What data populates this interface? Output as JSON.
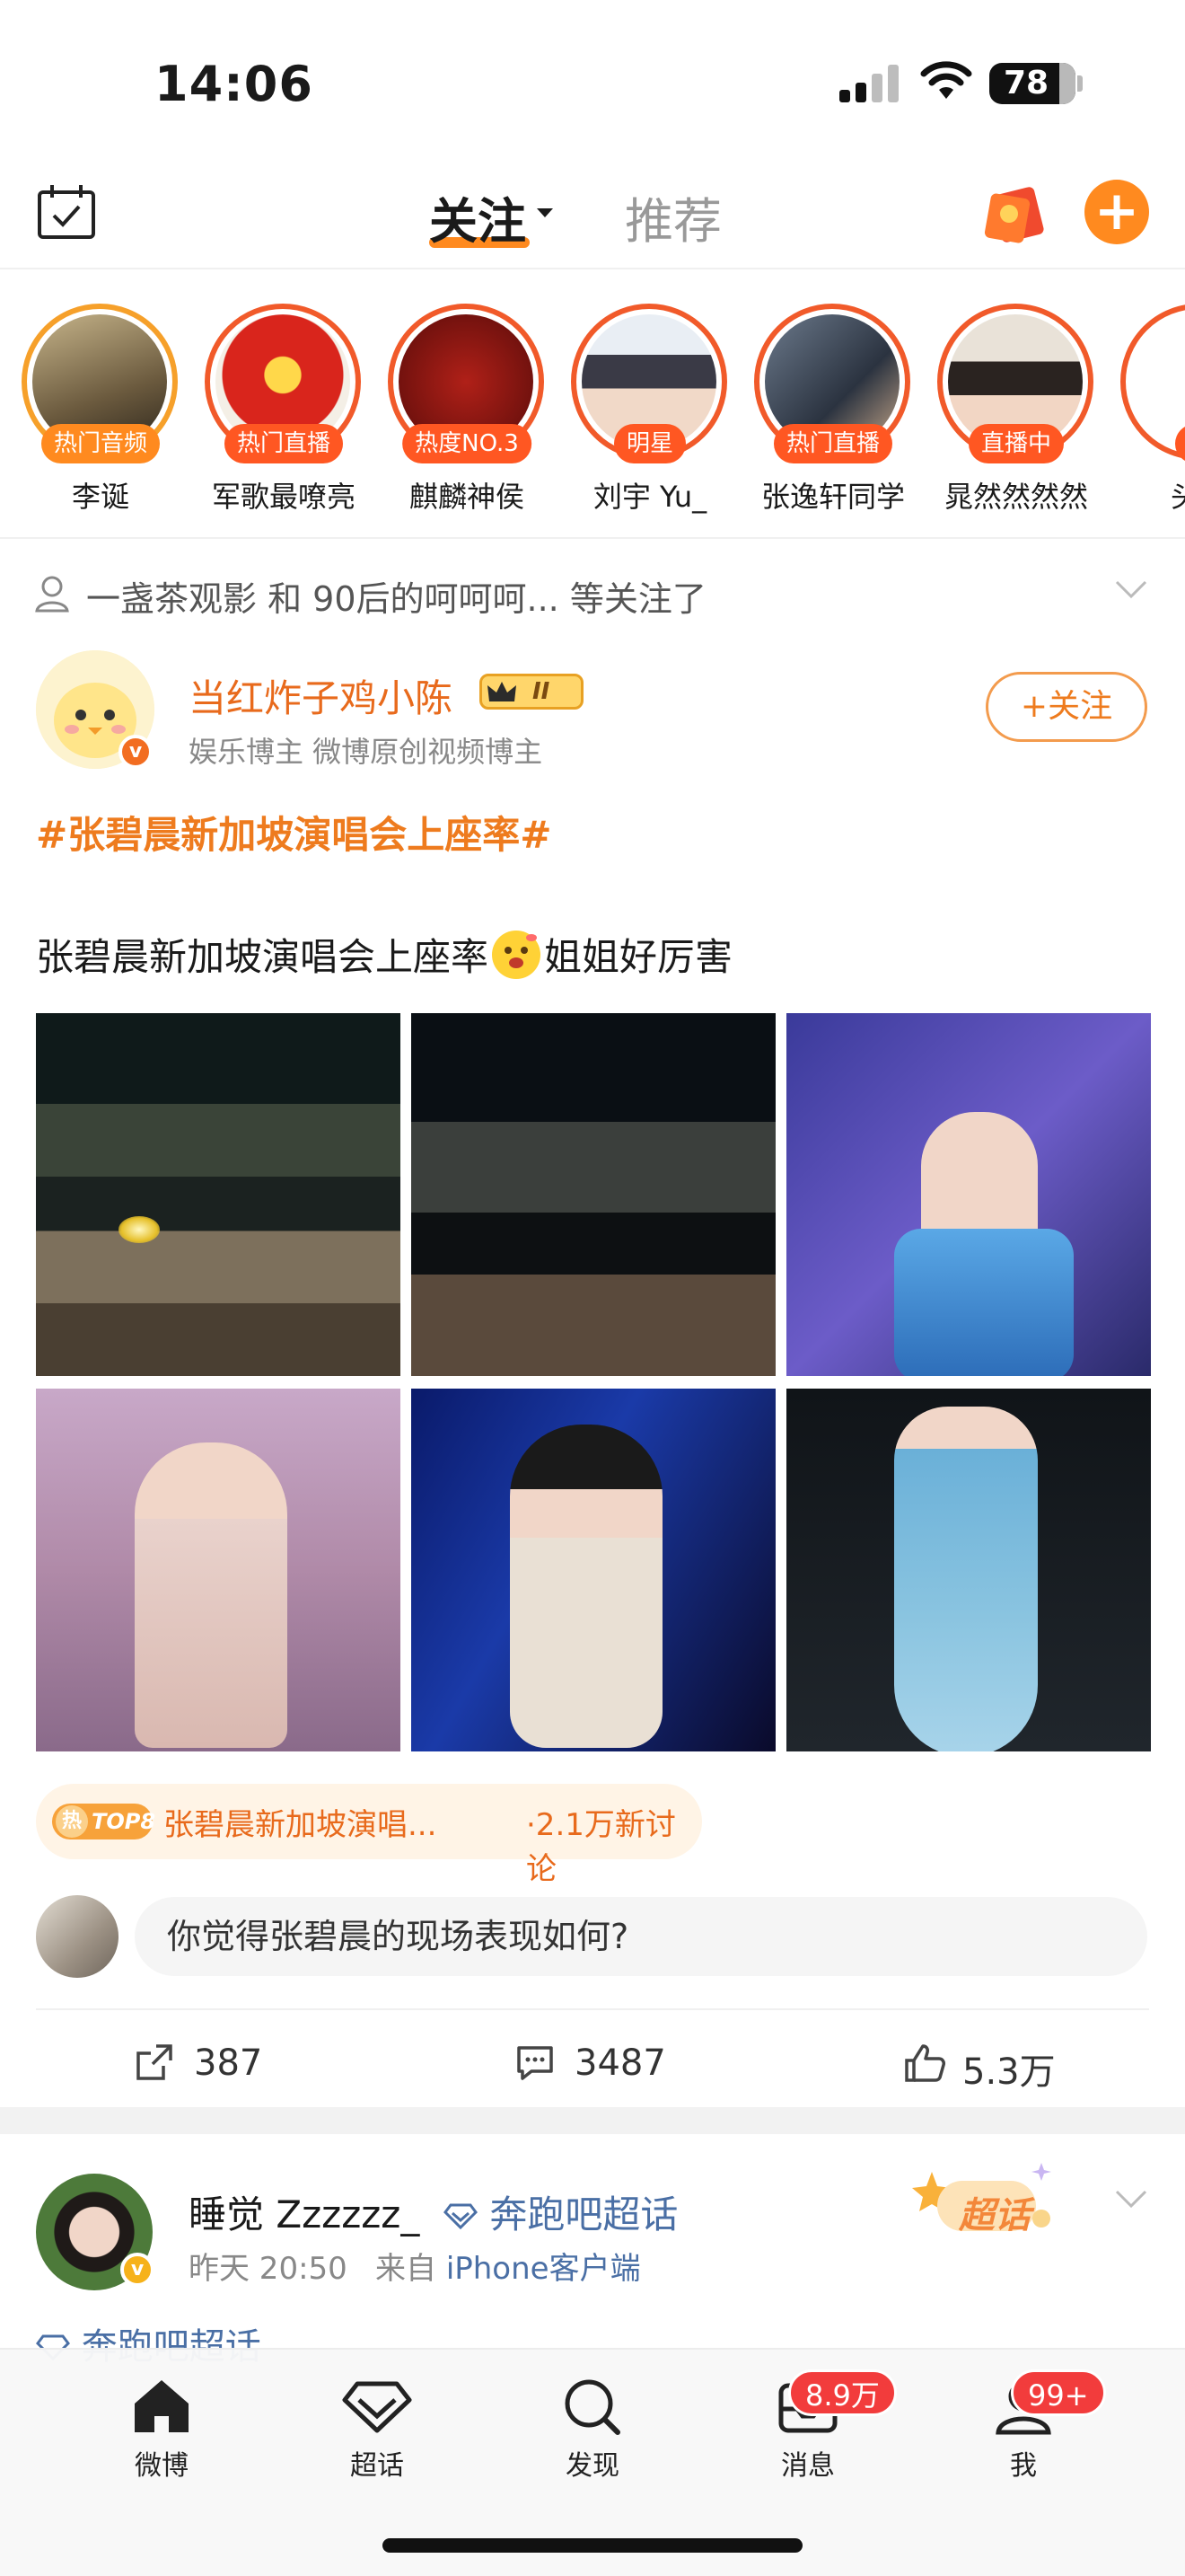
{
  "status_bar": {
    "time": "14:06",
    "battery": "78"
  },
  "top_nav": {
    "tab_follow": "关注",
    "tab_recommend": "推荐"
  },
  "stories": [
    {
      "name": "李诞",
      "badge": "热门音频"
    },
    {
      "name": "军歌最嘹亮",
      "badge": "热门直播"
    },
    {
      "name": "麒麟神侯",
      "badge": "热度NO.3"
    },
    {
      "name": "刘宇 Yu_",
      "badge": "明星"
    },
    {
      "name": "张逸轩同学",
      "badge": "热门直播"
    },
    {
      "name": "晁然然然然",
      "badge": "直播中"
    },
    {
      "name": "头号",
      "badge": "热"
    }
  ],
  "notice": {
    "text": "一盏茶观影 和 90后的呵呵呵... 等关注了"
  },
  "post1": {
    "author": "当红炸子鸡小陈",
    "author_desc": "娱乐博主 微博原创视频博主",
    "level": "II",
    "v_mark": "v",
    "follow_label": "+关注",
    "topic": "#张碧晨新加坡演唱会上座率#",
    "text_before": "张碧晨新加坡演唱会上座率",
    "text_after": "姐姐好厉害",
    "hot_badge": "TOP8",
    "hot_badge_char": "热",
    "hot_title": "张碧晨新加坡演唱...",
    "hot_count": "·2.1万新讨论",
    "comment_placeholder": "你觉得张碧晨的现场表现如何?",
    "reposts": "387",
    "comments": "3487",
    "likes": "5.3万"
  },
  "post2": {
    "author": "睡觉 Zzzzzz_",
    "supertopic": "奔跑吧超话",
    "time": "昨天 20:50",
    "source_prefix": "来自",
    "source": "iPhone客户端",
    "sticker": "超话",
    "topic": "奔跑吧超话"
  },
  "tabbar": {
    "home": "微博",
    "super": "超话",
    "discover": "发现",
    "messages": "消息",
    "messages_badge": "8.9万",
    "me": "我",
    "me_badge": "99+"
  },
  "colors": {
    "accent": "#ff8a1f",
    "link": "#4a6fa5",
    "badge_red": "#f23c3c"
  }
}
